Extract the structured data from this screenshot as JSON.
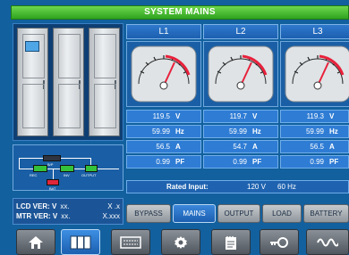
{
  "title": "SYSTEM MAINS",
  "phases": [
    {
      "label": "L1",
      "voltage": "119.5",
      "frequency": "59.99",
      "current": "56.5",
      "power_factor": "0.99"
    },
    {
      "label": "L2",
      "voltage": "119.7",
      "frequency": "59.99",
      "current": "54.7",
      "power_factor": "0.99"
    },
    {
      "label": "L3",
      "voltage": "119.3",
      "frequency": "59.99",
      "current": "56.5",
      "power_factor": "0.99"
    }
  ],
  "units": {
    "voltage": "V",
    "frequency": "Hz",
    "current": "A",
    "power_factor": "PF"
  },
  "rated": {
    "label": "Rated Input:",
    "voltage": "120 V",
    "frequency": "60 Hz"
  },
  "versions": {
    "lcd_label": "LCD VER: V",
    "lcd_value": "xx.",
    "lcd_suffix": "X  .x",
    "mtr_label": "MTR VER: V",
    "mtr_value": "xx.",
    "mtr_suffix": "X.xxx"
  },
  "diagram": {
    "bypass": "B/P",
    "rec": "REC",
    "inv": "INV",
    "output": "OUTPUT",
    "battery": "BAT"
  },
  "tabs": [
    "BYPASS",
    "MAINS",
    "OUTPUT",
    "LOAD",
    "BATTERY"
  ],
  "active_tab": "MAINS",
  "nav": [
    {
      "icon": "home-icon",
      "active": false
    },
    {
      "icon": "cabinet-icon",
      "active": true
    },
    {
      "icon": "ups-module-icon",
      "active": false
    },
    {
      "icon": "gear-icon",
      "active": false
    },
    {
      "icon": "notepad-icon",
      "active": false
    },
    {
      "icon": "key-icon",
      "active": false
    },
    {
      "icon": "waveform-icon",
      "active": false
    }
  ],
  "colors": {
    "accent": "#1c5fb0",
    "title_bar": "#3fb52a",
    "needle": "#e8213b"
  }
}
